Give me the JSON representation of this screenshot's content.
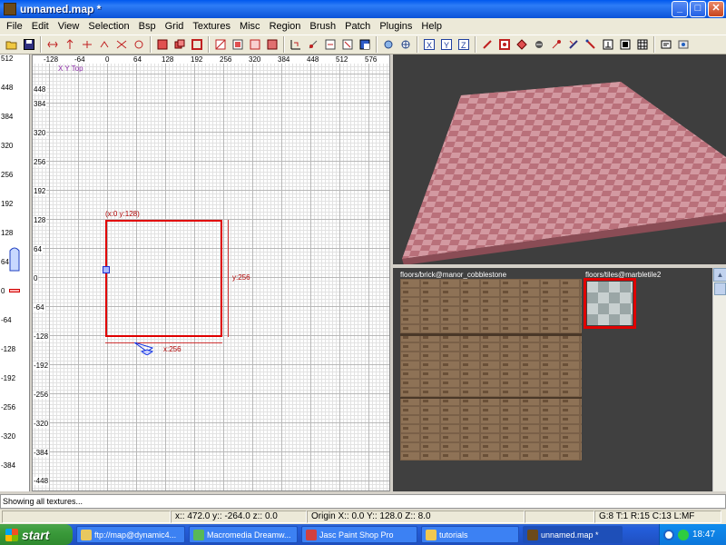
{
  "window": {
    "title": "unnamed.map *",
    "buttons": [
      "_",
      "□",
      "✕"
    ]
  },
  "menu": [
    "File",
    "Edit",
    "View",
    "Selection",
    "Bsp",
    "Grid",
    "Textures",
    "Misc",
    "Region",
    "Brush",
    "Patch",
    "Plugins",
    "Help"
  ],
  "view2d": {
    "label": "X Y Top",
    "h_ticks": [
      "-128",
      "-64",
      "0",
      "64",
      "128",
      "192",
      "256",
      "320",
      "384",
      "448",
      "512",
      "576"
    ],
    "v_ticks": [
      "448",
      "384",
      "320",
      "256",
      "192",
      "128",
      "64",
      "0",
      "-64",
      "-128",
      "-192",
      "-256",
      "-320",
      "-384",
      "-448"
    ],
    "brush_label_topleft": "(x:0  y:128)",
    "brush_label_height": "y:256",
    "brush_label_width": "x:256"
  },
  "left_ruler": {
    "ticks": [
      "512",
      "448",
      "384",
      "320",
      "256",
      "192",
      "128",
      "64",
      "0",
      "-64",
      "-128",
      "-192",
      "-256",
      "-320",
      "-384"
    ]
  },
  "textures": [
    {
      "name": "floors/brick@manor_cobblestone",
      "selected": false
    },
    {
      "name": "floors/tiles@marbletile2",
      "selected": true
    }
  ],
  "info": "Showing all textures...",
  "status": {
    "coords": "x:: 472.0  y:: -264.0  z:: 0.0",
    "origin": "Origin X:: 0.0  Y:: 128.0  Z:: 8.0",
    "grid": "G:8 T:1 R:15 C:13 L:MF"
  },
  "taskbar": {
    "start": "start",
    "tasks": [
      {
        "label": "ftp://map@dynamic4...",
        "color": "#e8c860",
        "active": false
      },
      {
        "label": "Macromedia Dreamw...",
        "color": "#58b858",
        "active": false
      },
      {
        "label": "Jasc Paint Shop Pro",
        "color": "#d04040",
        "active": false
      },
      {
        "label": "tutorials",
        "color": "#f0c850",
        "active": false
      },
      {
        "label": "unnamed.map *",
        "color": "#6b4a1a",
        "active": true
      }
    ],
    "clock": "18:47"
  },
  "colors": {
    "brush_outline": "#e00000",
    "view3d_bg": "#3e3e3e",
    "title_bar": "#0a52d8"
  }
}
